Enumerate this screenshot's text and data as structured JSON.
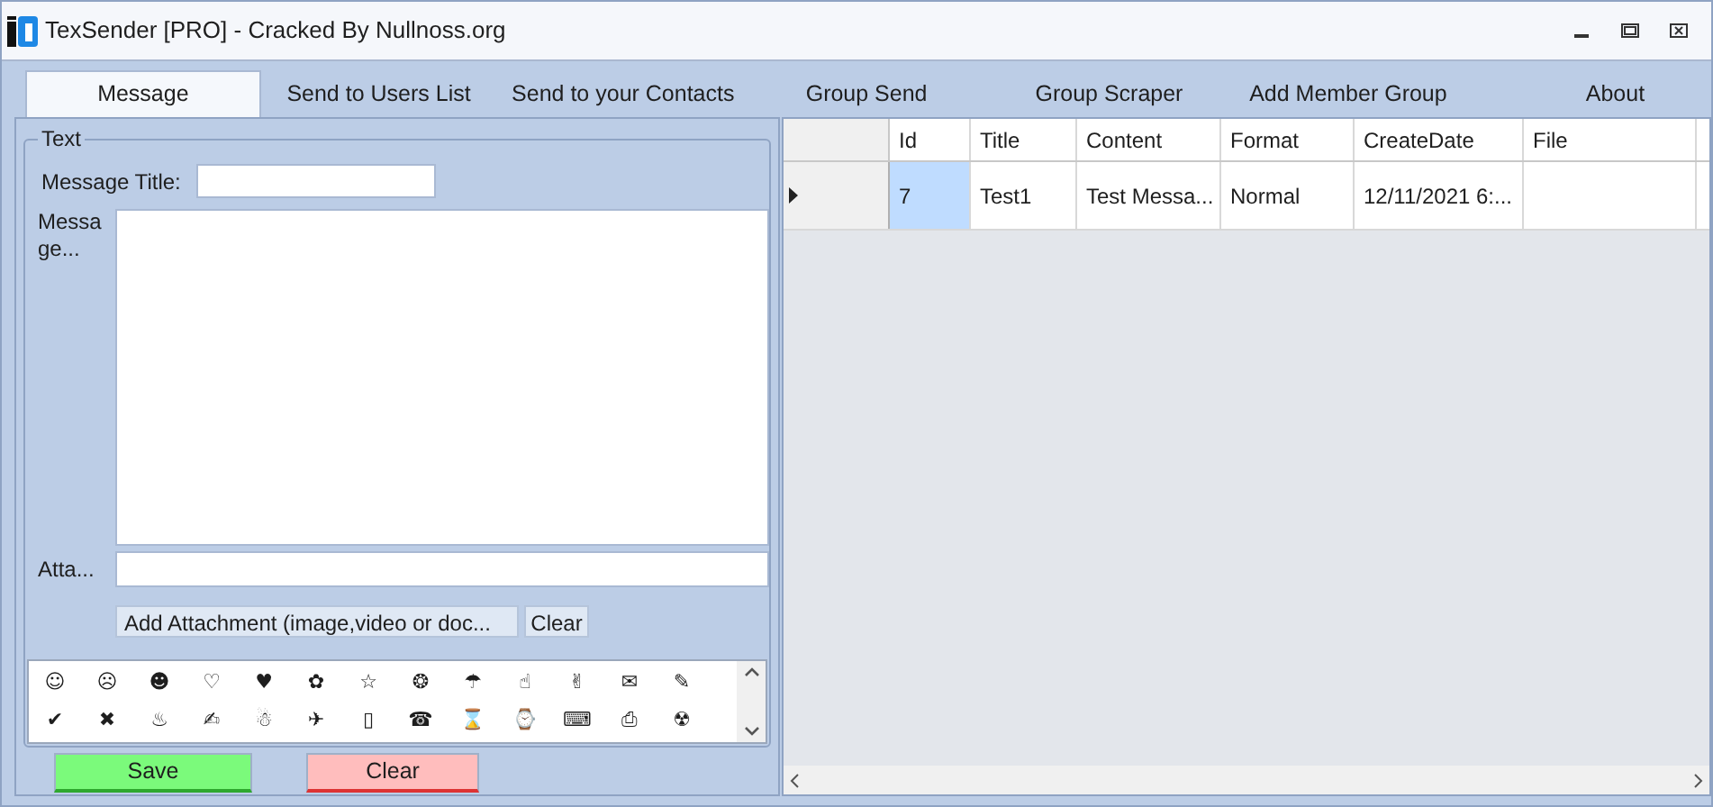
{
  "window": {
    "title": "TexSender [PRO] - Cracked By Nullnoss.org"
  },
  "tabs": [
    {
      "label": "Message",
      "selected": true
    },
    {
      "label": "Send to Users List",
      "selected": false
    },
    {
      "label": "Send to your Contacts",
      "selected": false
    },
    {
      "label": "Group Send",
      "selected": false
    },
    {
      "label": "Group Scraper",
      "selected": false
    },
    {
      "label": "Add Member Group",
      "selected": false
    },
    {
      "label": "About",
      "selected": false
    }
  ],
  "form": {
    "group_title": "Text",
    "title_label": "Message Title:",
    "message_label": "Messa ge...",
    "attachment_label": "Atta...",
    "add_attachment_button": "Add  Attachment  (image,video  or doc...",
    "clear_attachment_button": "Clear",
    "emojis": [
      [
        "☺",
        "☹",
        "☻",
        "♡",
        "♥",
        "✿",
        "☆",
        "❂",
        "☂",
        "☝",
        "✌",
        "✉",
        "✎"
      ],
      [
        "✔",
        "✖",
        "♨",
        "✍",
        "☃",
        "✈",
        "▯",
        "☎",
        "⌛",
        "⌚",
        "⌨",
        "⎙",
        "☢"
      ]
    ],
    "save_button": "Save",
    "clear_button": "Clear"
  },
  "table": {
    "columns": [
      "Id",
      "Title",
      "Content",
      "Format",
      "CreateDate",
      "File"
    ],
    "rows": [
      {
        "current": true,
        "cells": [
          {
            "text": "7",
            "selected": true
          },
          {
            "text": "Test1",
            "selected": false
          },
          {
            "text": "Test Messa...",
            "selected": false
          },
          {
            "text": "Normal",
            "selected": false
          },
          {
            "text": "12/11/2021 6:...",
            "selected": false
          }
        ]
      }
    ]
  }
}
